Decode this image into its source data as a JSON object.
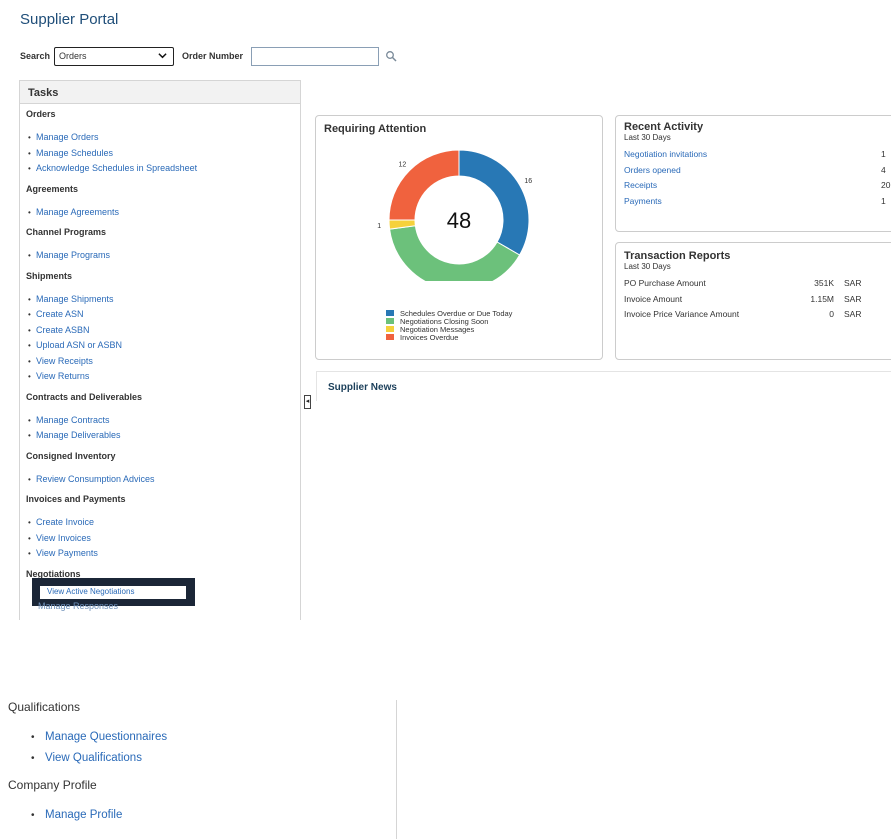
{
  "header": {
    "title": "Supplier Portal"
  },
  "search": {
    "label": "Search",
    "selected": "Orders",
    "order_label": "Order Number",
    "order_value": ""
  },
  "tasks": {
    "title": "Tasks",
    "categories": [
      {
        "name": "Orders",
        "links": [
          "Manage Orders",
          "Manage Schedules",
          "Acknowledge Schedules in Spreadsheet"
        ]
      },
      {
        "name": "Agreements",
        "links": [
          "Manage Agreements"
        ]
      },
      {
        "name": "Channel Programs",
        "links": [
          "Manage Programs"
        ]
      },
      {
        "name": "Shipments",
        "links": [
          "Manage Shipments",
          "Create ASN",
          "Create ASBN",
          "Upload ASN or ASBN",
          "View Receipts",
          "View Returns"
        ]
      },
      {
        "name": "Contracts and Deliverables",
        "links": [
          "Manage Contracts",
          "Manage Deliverables"
        ]
      },
      {
        "name": "Consigned Inventory",
        "links": [
          "Review Consumption Advices"
        ]
      },
      {
        "name": "Invoices and Payments",
        "links": [
          "Create Invoice",
          "View Invoices",
          "View Payments"
        ]
      },
      {
        "name": "Negotiations",
        "links": []
      }
    ],
    "highlighted_link": "View Active Negotiations",
    "partial_link": "Manage Responses"
  },
  "requiring_attention": {
    "title": "Requiring Attention",
    "total": "48",
    "segments": [
      {
        "label": "Schedules Overdue or Due Today",
        "value": 16,
        "color": "#2878b5"
      },
      {
        "label": "Negotiations Closing Soon",
        "value": 19,
        "color": "#6cc17b"
      },
      {
        "label": "Negotiation Messages",
        "value": 1,
        "color": "#f5d13b"
      },
      {
        "label": "Invoices Overdue",
        "value": 12,
        "color": "#f0623e"
      }
    ]
  },
  "recent_activity": {
    "title": "Recent Activity",
    "subtitle": "Last 30 Days",
    "rows": [
      {
        "label": "Negotiation invitations",
        "count": "1"
      },
      {
        "label": "Orders opened",
        "count": "4"
      },
      {
        "label": "Receipts",
        "count": "20"
      },
      {
        "label": "Payments",
        "count": "1"
      }
    ]
  },
  "transaction_reports": {
    "title": "Transaction Reports",
    "subtitle": "Last 30 Days",
    "rows": [
      {
        "label": "PO Purchase Amount",
        "amount": "351K",
        "currency": "SAR"
      },
      {
        "label": "Invoice Amount",
        "amount": "1.15M",
        "currency": "SAR"
      },
      {
        "label": "Invoice Price Variance Amount",
        "amount": "0",
        "currency": "SAR"
      }
    ]
  },
  "supplier_news": {
    "title": "Supplier News"
  },
  "bottom_tasks": {
    "categories": [
      {
        "name": "Qualifications",
        "links": [
          "Manage Questionnaires",
          "View Qualifications"
        ]
      },
      {
        "name": "Company Profile",
        "links": [
          "Manage Profile"
        ]
      }
    ]
  }
}
